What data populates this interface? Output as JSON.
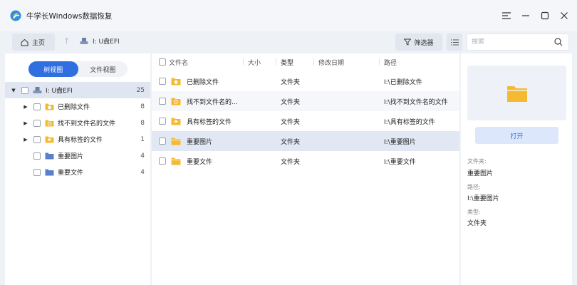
{
  "app": {
    "title": "牛学长Windows数据恢复"
  },
  "toolbar": {
    "home_label": "主页",
    "drive_label": "I: U盘EFI",
    "filter_label": "筛选器",
    "search_placeholder": "搜索"
  },
  "tree": {
    "tab_tree": "树视图",
    "tab_file": "文件视图",
    "active_tab": "树视图",
    "root": {
      "label": "I: U盘EFI",
      "count": "25"
    },
    "items": [
      {
        "label": "已删除文件",
        "count": "8",
        "icon": "deleted-folder-icon"
      },
      {
        "label": "找不到文件名的文件",
        "count": "8",
        "icon": "unknown-folder-icon"
      },
      {
        "label": "具有标签的文件",
        "count": "1",
        "icon": "tagged-folder-icon"
      },
      {
        "label": "重要图片",
        "count": "4",
        "icon": "blue-folder-icon"
      },
      {
        "label": "重要文件",
        "count": "4",
        "icon": "blue-folder-icon"
      }
    ]
  },
  "table": {
    "headers": {
      "name": "文件名",
      "size": "大小",
      "type": "类型",
      "date": "修改日期",
      "path": "路径"
    },
    "rows": [
      {
        "name": "已删除文件",
        "size": "",
        "type": "文件夹",
        "date": "",
        "path": "I:\\已删除文件",
        "icon": "deleted-folder-icon"
      },
      {
        "name": "找不到文件名的...",
        "size": "",
        "type": "文件夹",
        "date": "",
        "path": "I:\\找不到文件名的文件",
        "icon": "unknown-folder-icon"
      },
      {
        "name": "具有标签的文件",
        "size": "",
        "type": "文件夹",
        "date": "",
        "path": "I:\\具有标签的文件",
        "icon": "tagged-folder-icon"
      },
      {
        "name": "重要图片",
        "size": "",
        "type": "文件夹",
        "date": "",
        "path": "I:\\重要图片",
        "icon": "yellow-folder-icon"
      },
      {
        "name": "重要文件",
        "size": "",
        "type": "文件夹",
        "date": "",
        "path": "I:\\重要文件",
        "icon": "yellow-folder-icon"
      }
    ],
    "selected_row": "重要图片"
  },
  "detail": {
    "open_label": "打开",
    "folder_label": "文件夹:",
    "folder_value": "重要图片",
    "path_label": "路径:",
    "path_value": "I:\\重要图片",
    "type_label": "类型:",
    "type_value": "文件夹"
  },
  "colors": {
    "accent": "#2f6fe0",
    "folder_yellow": "#f5b932",
    "folder_blue": "#5a7fd0",
    "selected_bg": "#e1e7f3"
  }
}
